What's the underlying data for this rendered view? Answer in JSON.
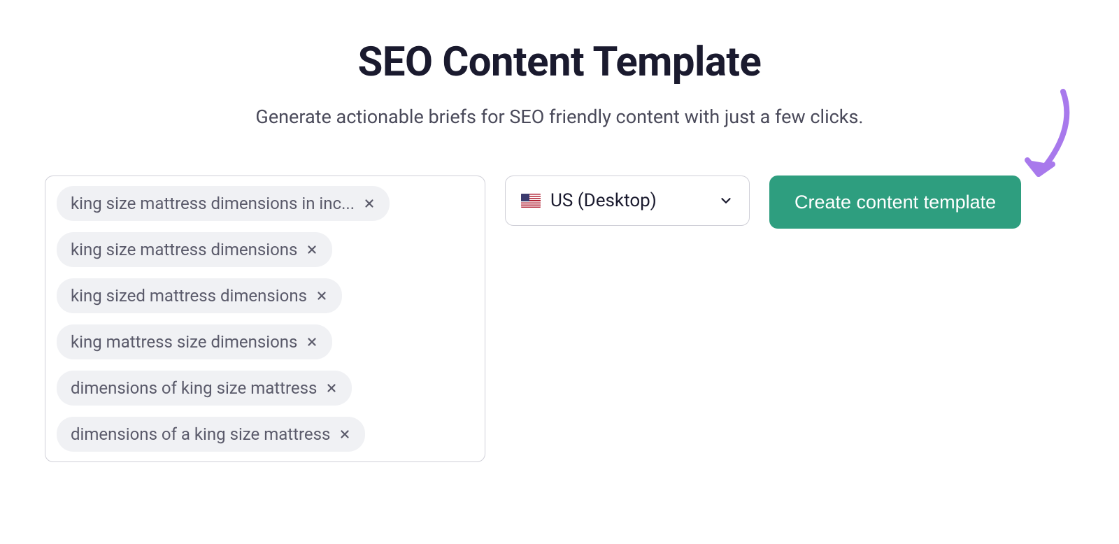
{
  "header": {
    "title": "SEO Content Template",
    "subtitle": "Generate actionable briefs for SEO friendly content with just a few clicks."
  },
  "keywords": [
    {
      "label": "king size mattress dimensions in inc..."
    },
    {
      "label": "king size mattress dimensions"
    },
    {
      "label": "king sized mattress dimensions"
    },
    {
      "label": "king mattress size dimensions"
    },
    {
      "label": "dimensions of king size mattress"
    },
    {
      "label": "dimensions of a king size mattress"
    }
  ],
  "locale": {
    "flag": "us",
    "label": "US (Desktop)"
  },
  "actions": {
    "create_label": "Create content template"
  },
  "colors": {
    "primary_button": "#2e9e7f",
    "annotation_arrow": "#a879ec",
    "tag_bg": "#f0f1f4",
    "text_dark": "#1a1a2e",
    "text_muted": "#5a5a6a"
  }
}
